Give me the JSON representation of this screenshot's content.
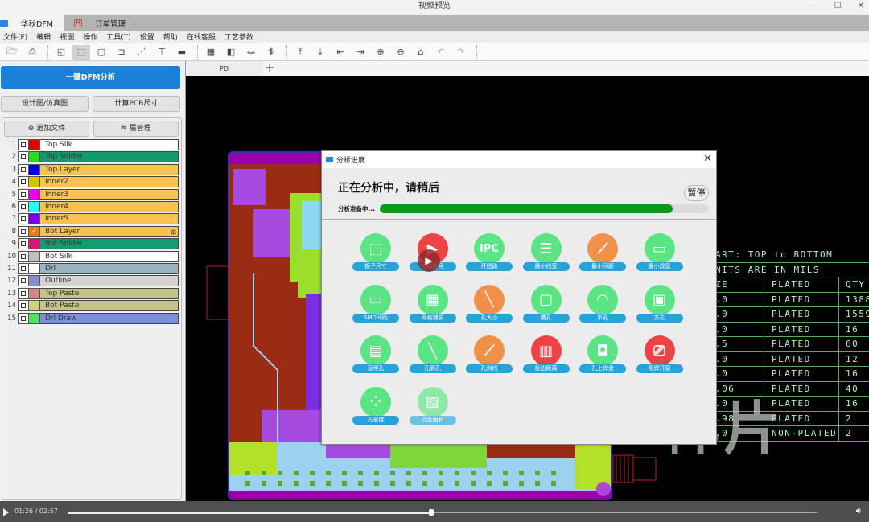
{
  "window": {
    "title": "视频预览",
    "controls": [
      "—",
      "☐",
      "✕"
    ]
  },
  "app_tabs": [
    {
      "label": "华秋DFM",
      "active": true
    },
    {
      "label": "订单管理",
      "active": false
    }
  ],
  "menu": [
    "文件(F)",
    "编辑",
    "视图",
    "操作",
    "工具(T)",
    "设置",
    "帮助",
    "在线客服",
    "工艺参数"
  ],
  "toolbar": {
    "icons": [
      "open-icon",
      "print-icon",
      "layout-icon",
      "select-icon",
      "select-box-icon",
      "move-icon",
      "net-icon",
      "route-icon",
      "measure-icon",
      "grid-icon",
      "component-icon",
      "signal-icon",
      "connect-icon",
      "upload-icon",
      "download-icon",
      "shrink-left-icon",
      "expand-right-icon",
      "zoom-in-icon",
      "zoom-out-icon",
      "home-icon",
      "undo-icon",
      "redo-icon"
    ]
  },
  "left_panel": {
    "dfm_button": "一键DFM分析",
    "design_view_button": "设计图/仿真图",
    "calc_pcb_size_button": "计算PCB尺寸",
    "add_file_button": "追加文件",
    "layer_mgmt_button": "层管理",
    "layers": [
      {
        "num": "1",
        "name": "Top Silk",
        "swatch": "#e00000",
        "bg": "#ffffff",
        "checked": false
      },
      {
        "num": "2",
        "name": "Top Solder",
        "swatch": "#22dd22",
        "bg": "#129a70",
        "checked": false
      },
      {
        "num": "3",
        "name": "Top Layer",
        "swatch": "#0000dd",
        "bg": "#f7c24f",
        "checked": false
      },
      {
        "num": "4",
        "name": "Inner2",
        "swatch": "#d4c400",
        "bg": "#f7c24f",
        "checked": false
      },
      {
        "num": "5",
        "name": "Inner3",
        "swatch": "#ee00ee",
        "bg": "#f7c24f",
        "checked": false
      },
      {
        "num": "6",
        "name": "Inner4",
        "swatch": "#22ffff",
        "bg": "#f7c24f",
        "checked": false
      },
      {
        "num": "7",
        "name": "Inner5",
        "swatch": "#7700ee",
        "bg": "#f7c24f",
        "checked": false
      },
      {
        "num": "8",
        "name": "Bot Layer",
        "swatch": "#f07a10",
        "bg": "#f7c24f",
        "checked": true,
        "extra": "⊞"
      },
      {
        "num": "9",
        "name": "Bot Solder",
        "swatch": "#e0107a",
        "bg": "#129a70",
        "checked": false
      },
      {
        "num": "10",
        "name": "Bot Silk",
        "swatch": "#c0c0c0",
        "bg": "#ffffff",
        "checked": false
      },
      {
        "num": "11",
        "name": "Drl",
        "swatch": "#ffffff",
        "bg": "#99b4be",
        "checked": false
      },
      {
        "num": "12",
        "name": "Outline",
        "swatch": "#8a8ad0",
        "bg": "#d3d3d3",
        "checked": false
      },
      {
        "num": "13",
        "name": "Top Paste",
        "swatch": "#cc8888",
        "bg": "#c3c38a",
        "checked": false
      },
      {
        "num": "14",
        "name": "Bot Paste",
        "swatch": "#d0d080",
        "bg": "#c3c38a",
        "checked": false
      },
      {
        "num": "15",
        "name": "Drl Draw",
        "swatch": "#55dd66",
        "bg": "#7a90d8",
        "checked": false
      }
    ]
  },
  "canvas": {
    "doc_tab": "PD",
    "add_tab": "+",
    "drill_table": {
      "header_lines": [
        "ART: TOP to BOTTOM",
        "NITS ARE IN MILS"
      ],
      "columns": [
        "ZE",
        "PLATED",
        "QTY"
      ],
      "rows": [
        [
          ".0",
          "PLATED",
          "1388"
        ],
        [
          ".0",
          "PLATED",
          "1559"
        ],
        [
          ".0",
          "PLATED",
          "16"
        ],
        [
          ".5",
          "PLATED",
          "60"
        ],
        [
          ".0",
          "PLATED",
          "12"
        ],
        [
          ".0",
          "PLATED",
          "16"
        ],
        [
          ".06",
          "PLATED",
          "40"
        ],
        [
          ".0",
          "PLATED",
          "16"
        ],
        [
          ".98",
          "PLATED",
          "2"
        ],
        [
          ".0",
          "NON-PLATED",
          "2"
        ]
      ]
    },
    "watermark": "样片"
  },
  "dialog": {
    "title": "分析进度",
    "heading": "正在分析中，请稍后",
    "pause_button": "暂停",
    "status": "分析准备中...",
    "progress_percent": 89,
    "items": [
      {
        "label": "板子尺寸",
        "color": "green",
        "icon": "board-size-icon",
        "glyph": "⬚"
      },
      {
        "label": "电器信号",
        "color": "red",
        "icon": "electrical-signal-icon",
        "glyph": "▶"
      },
      {
        "label": "开短路",
        "color": "green",
        "icon": "ipc-icon",
        "glyph": "IPC"
      },
      {
        "label": "最小线宽",
        "color": "green",
        "icon": "min-trace-width-icon",
        "glyph": "☰"
      },
      {
        "label": "最小间距",
        "color": "orange",
        "icon": "min-spacing-icon",
        "glyph": "⟋"
      },
      {
        "label": "最小焊盘",
        "color": "green",
        "icon": "min-pad-icon",
        "glyph": "▭"
      },
      {
        "label": "SMD间距",
        "color": "green",
        "icon": "smd-spacing-icon",
        "glyph": "▭"
      },
      {
        "label": "网格铺铜",
        "color": "green",
        "icon": "mesh-copper-icon",
        "glyph": "▦"
      },
      {
        "label": "孔大小",
        "color": "orange",
        "icon": "hole-size-icon",
        "glyph": "╲"
      },
      {
        "label": "槽孔",
        "color": "green",
        "icon": "slot-hole-icon",
        "glyph": "▢"
      },
      {
        "label": "半孔",
        "color": "green",
        "icon": "half-hole-icon",
        "glyph": "◠"
      },
      {
        "label": "方孔",
        "color": "green",
        "icon": "square-hole-icon",
        "glyph": "▣"
      },
      {
        "label": "盲埋孔",
        "color": "green",
        "icon": "blind-buried-via-icon",
        "glyph": "▤"
      },
      {
        "label": "孔到孔",
        "color": "green",
        "icon": "hole-to-hole-icon",
        "glyph": "╲"
      },
      {
        "label": "孔到线",
        "color": "orange",
        "icon": "hole-to-trace-icon",
        "glyph": "⟋"
      },
      {
        "label": "板边距离",
        "color": "red",
        "icon": "board-edge-distance-icon",
        "glyph": "▥"
      },
      {
        "label": "孔上焊盘",
        "color": "green",
        "icon": "pad-on-hole-icon",
        "glyph": "◘"
      },
      {
        "label": "阻焊开窗",
        "color": "red",
        "icon": "solder-mask-window-icon",
        "glyph": "⎚"
      },
      {
        "label": "孔密度",
        "color": "green",
        "icon": "hole-density-icon",
        "glyph": "⁘"
      },
      {
        "label": "沉金面积",
        "color": "pale",
        "icon": "gold-area-icon",
        "glyph": "▨"
      }
    ]
  },
  "player": {
    "time": "01:26 / 02:57",
    "progress_fraction": 0.486
  }
}
